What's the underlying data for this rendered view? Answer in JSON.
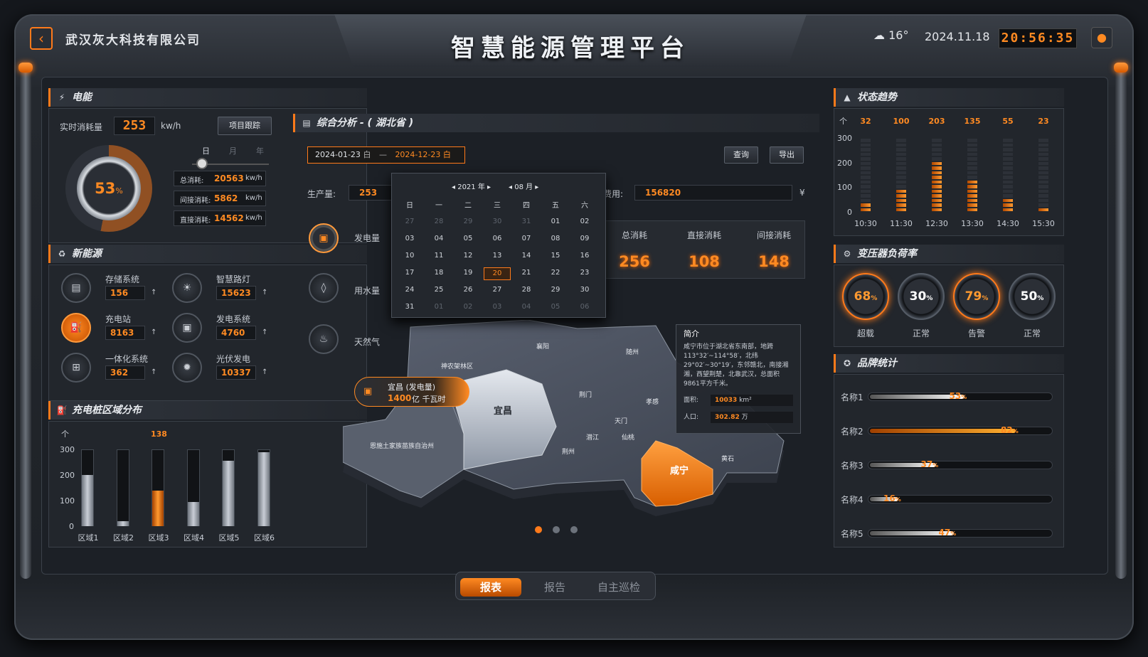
{
  "header": {
    "company": "武汉灰大科技有限公司",
    "title": "智慧能源管理平台",
    "weather_temp": "16°",
    "date": "2024.11.18",
    "time": "20:56:35"
  },
  "energy": {
    "section": "电能",
    "realtime_label": "实时消耗量",
    "realtime_value": "253",
    "unit": "kw/h",
    "track_btn": "项目跟踪",
    "gauge_pct": "53",
    "gauge_sym": "%",
    "periods": [
      "日",
      "月",
      "年"
    ],
    "rows": [
      {
        "label": "总消耗:",
        "value": "20563",
        "unit": "kw/h"
      },
      {
        "label": "间接消耗:",
        "value": "5862",
        "unit": "kw/h"
      },
      {
        "label": "直接消耗:",
        "value": "14562",
        "unit": "kw/h"
      }
    ]
  },
  "new_energy": {
    "section": "新能源",
    "items": [
      {
        "label": "存储系统",
        "value": "156",
        "icon": "battery-icon"
      },
      {
        "label": "智慧路灯",
        "value": "15623",
        "icon": "lamp-icon"
      },
      {
        "label": "充电站",
        "value": "8163",
        "icon": "charger-icon"
      },
      {
        "label": "发电系统",
        "value": "4760",
        "icon": "generator-icon"
      },
      {
        "label": "一体化系统",
        "value": "362",
        "icon": "network-icon"
      },
      {
        "label": "光伏发电",
        "value": "10337",
        "icon": "solar-icon"
      }
    ],
    "arrow": "↑"
  },
  "charging": {
    "section": "充电桩区域分布",
    "unit_mark": "个",
    "peak_label": "138"
  },
  "analysis": {
    "section": "综合分析 - ( 湖北省 )",
    "date_start": "2024-01-23",
    "date_end": "2024-12-23",
    "date_sep": "—",
    "cal_icon": "白",
    "query": "查询",
    "export": "导出",
    "prod_label": "生产量:",
    "prod_value": "253",
    "cost_label": "费用:",
    "cost_value": "156820",
    "currency": "¥",
    "side": [
      "发电量",
      "用水量",
      "天然气"
    ],
    "totals": [
      {
        "label": "总消耗",
        "value": "256"
      },
      {
        "label": "直接消耗",
        "value": "108"
      },
      {
        "label": "间接消耗",
        "value": "148"
      }
    ]
  },
  "calendar": {
    "year": "2021 年",
    "month": "08 月",
    "weekdays": [
      "日",
      "一",
      "二",
      "三",
      "四",
      "五",
      "六"
    ],
    "days": [
      [
        "27",
        "28",
        "29",
        "30",
        "31",
        "01",
        "02"
      ],
      [
        "03",
        "04",
        "05",
        "06",
        "07",
        "08",
        "09"
      ],
      [
        "10",
        "11",
        "12",
        "13",
        "14",
        "15",
        "16"
      ],
      [
        "17",
        "18",
        "19",
        "20",
        "21",
        "22",
        "23"
      ],
      [
        "24",
        "25",
        "26",
        "27",
        "28",
        "29",
        "30"
      ],
      [
        "31",
        "01",
        "02",
        "03",
        "04",
        "05",
        "06"
      ]
    ]
  },
  "map": {
    "regions": [
      "襄阳",
      "随州",
      "神农架林区",
      "荆门",
      "孝感",
      "天门",
      "潜江",
      "仙桃",
      "荆州",
      "恩施土家族苗族自治州",
      "黄石"
    ],
    "yichang": "宜昌",
    "xianning": "咸宁",
    "badge_title": "宜昌 (发电量)",
    "badge_value": "1400",
    "badge_unit": "亿 千瓦时",
    "tip_title": "简介",
    "tip_text": "咸宁市位于湖北省东南部，地跨113°32′~114°58′，北纬29°02′~30°19′，东邻赣北，南接湘湘，西望荆楚，北靠武汉，总面积9861平方千米。",
    "area_label": "面积:",
    "area_value": "10033",
    "area_unit": "km²",
    "pop_label": "人口:",
    "pop_value": "302.82",
    "pop_unit": "万"
  },
  "trend": {
    "section": "状态趋势",
    "unit_mark": "个",
    "top": [
      "32",
      "100",
      "203",
      "135",
      "55",
      "23"
    ],
    "times": [
      "10:30",
      "11:30",
      "12:30",
      "13:30",
      "14:30",
      "15:30"
    ]
  },
  "transformer": {
    "section": "变压器负荷率",
    "items": [
      {
        "pct": "68",
        "sym": "%",
        "label": "超载"
      },
      {
        "pct": "30",
        "sym": "%",
        "label": "正常"
      },
      {
        "pct": "79",
        "sym": "%",
        "label": "告警"
      },
      {
        "pct": "50",
        "sym": "%",
        "label": "正常"
      }
    ]
  },
  "brand": {
    "section": "品牌统计",
    "items": [
      {
        "name": "名称1",
        "pct": "53",
        "sym": "%"
      },
      {
        "name": "名称2",
        "pct": "82",
        "sym": "%"
      },
      {
        "name": "名称3",
        "pct": "37",
        "sym": "%"
      },
      {
        "name": "名称4",
        "pct": "16",
        "sym": "%"
      },
      {
        "name": "名称5",
        "pct": "47",
        "sym": "%"
      }
    ]
  },
  "tabs": [
    "报表",
    "报告",
    "自主巡检"
  ],
  "chart_data": [
    {
      "type": "bar",
      "title": "充电桩区域分布",
      "categories": [
        "区域1",
        "区域2",
        "区域3",
        "区域4",
        "区域5",
        "区域6"
      ],
      "values": [
        200,
        20,
        138,
        95,
        255,
        290
      ],
      "ylim": [
        0,
        300
      ],
      "yticks": [
        "300",
        "200",
        "100",
        "0"
      ]
    },
    {
      "type": "bar",
      "title": "状态趋势",
      "categories": [
        "10:30",
        "11:30",
        "12:30",
        "13:30",
        "14:30",
        "15:30"
      ],
      "values": [
        32,
        100,
        203,
        135,
        55,
        23
      ],
      "ylim": [
        0,
        300
      ],
      "yticks": [
        "300",
        "200",
        "100",
        "0"
      ]
    }
  ]
}
